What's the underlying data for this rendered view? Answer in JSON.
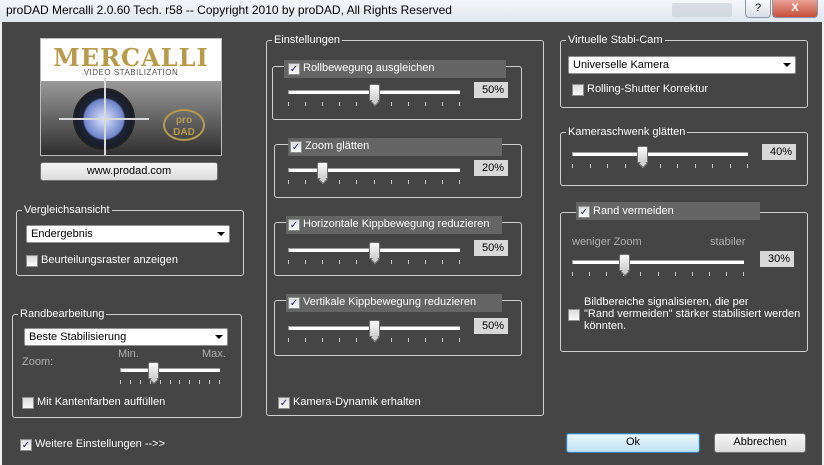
{
  "window": {
    "title": "proDAD Mercalli 2.0.60 Tech. r58 -- Copyright 2010 by proDAD, All Rights Reserved",
    "help_label": "?",
    "close_label": "X"
  },
  "logo": {
    "title": "MERCALLI",
    "subtitle": "VIDEO STABILIZATION",
    "badge": "pro DAD",
    "link_label": "www.prodad.com"
  },
  "vergleich": {
    "legend": "Vergleichsansicht",
    "select_value": "Endergebnis",
    "raster_label": "Beurteilungsraster anzeigen",
    "raster_checked": false
  },
  "randbearbeitung": {
    "legend": "Randbearbeitung",
    "select_value": "Beste Stabilisierung",
    "zoom_label": "Zoom:",
    "min_label": "Min.",
    "max_label": "Max.",
    "zoom_value": 0.33,
    "kanten_label": "Mit Kantenfarben auffüllen",
    "kanten_checked": false
  },
  "weitere": {
    "label": "Weitere Einstellungen -->>",
    "checked": true
  },
  "einstellungen": {
    "legend": "Einstellungen",
    "roll": {
      "label": "Rollbewegung ausgleichen",
      "checked": true,
      "value": "50%",
      "fraction": 0.5
    },
    "zoom": {
      "label": "Zoom glätten",
      "checked": true,
      "value": "20%",
      "fraction": 0.2
    },
    "horizontal": {
      "label": "Horizontale Kippbewegung reduzieren",
      "checked": true,
      "value": "50%",
      "fraction": 0.5
    },
    "vertikal": {
      "label": "Vertikale Kippbewegung reduzieren",
      "checked": true,
      "value": "50%",
      "fraction": 0.5
    },
    "kamera_dynamik": {
      "label": "Kamera-Dynamik erhalten",
      "checked": true
    }
  },
  "stabicam": {
    "legend": "Virtuelle Stabi-Cam",
    "select_value": "Universelle Kamera",
    "rolling_label": "Rolling-Shutter Korrektur",
    "rolling_checked": false
  },
  "kameraschwenk": {
    "legend": "Kameraschwenk glätten",
    "value": "40%",
    "fraction": 0.4
  },
  "rand": {
    "label": "Rand vermeiden",
    "checked": true,
    "weniger_label": "weniger Zoom",
    "stabiler_label": "stabiler",
    "value": "30%",
    "fraction": 0.3,
    "signal_label_1": "Bildbereiche signalisieren, die per",
    "signal_label_2": "\"Rand vermeiden\" stärker stabilisiert werden",
    "signal_label_3": "könnten.",
    "signal_checked": false
  },
  "buttons": {
    "ok": "Ok",
    "cancel": "Abbrechen"
  }
}
